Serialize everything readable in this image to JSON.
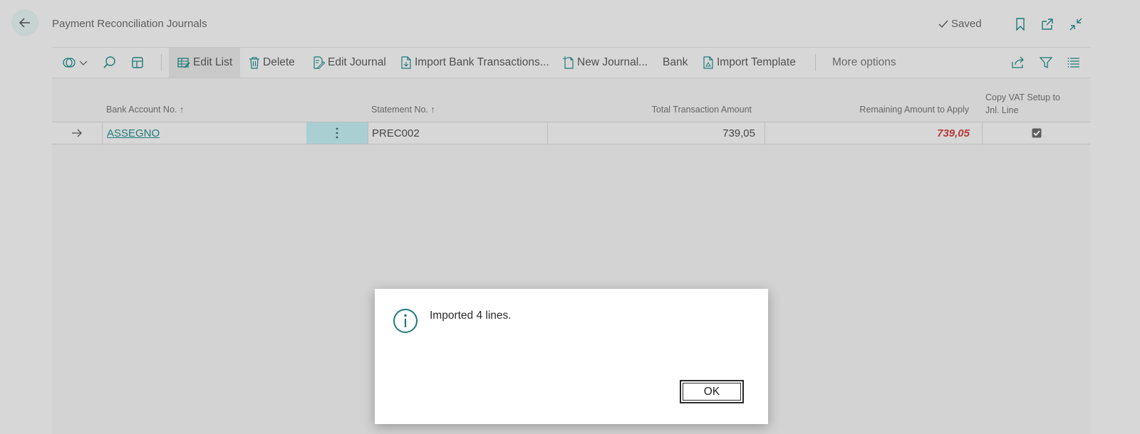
{
  "header": {
    "title": "Payment Reconciliation Journals",
    "saved_label": "Saved"
  },
  "toolbar": {
    "edit_list": "Edit List",
    "delete": "Delete",
    "edit_journal": "Edit Journal",
    "import_bank_transactions": "Import Bank Transactions...",
    "new_journal": "New Journal...",
    "bank": "Bank",
    "import_template": "Import Template",
    "more_options": "More options"
  },
  "table": {
    "columns": {
      "bank_account_no": "Bank Account No.",
      "statement_no": "Statement No.",
      "total_transaction_amount": "Total Transaction Amount",
      "remaining_amount_to_apply": "Remaining Amount to Apply",
      "copy_vat_setup_line1": "Copy VAT Setup to",
      "copy_vat_setup_line2": "Jnl. Line"
    },
    "rows": [
      {
        "bank_account_no": "ASSEGNO",
        "statement_no": "PREC002",
        "total_transaction_amount": "739,05",
        "remaining_amount_to_apply": "739,05",
        "copy_vat_setup": true
      }
    ]
  },
  "dialog": {
    "message": "Imported 4 lines.",
    "ok_label": "OK"
  },
  "colors": {
    "accent": "#1f7a7a",
    "negative_amount": "#b83a3a",
    "selected_cell": "#aacfd3"
  }
}
